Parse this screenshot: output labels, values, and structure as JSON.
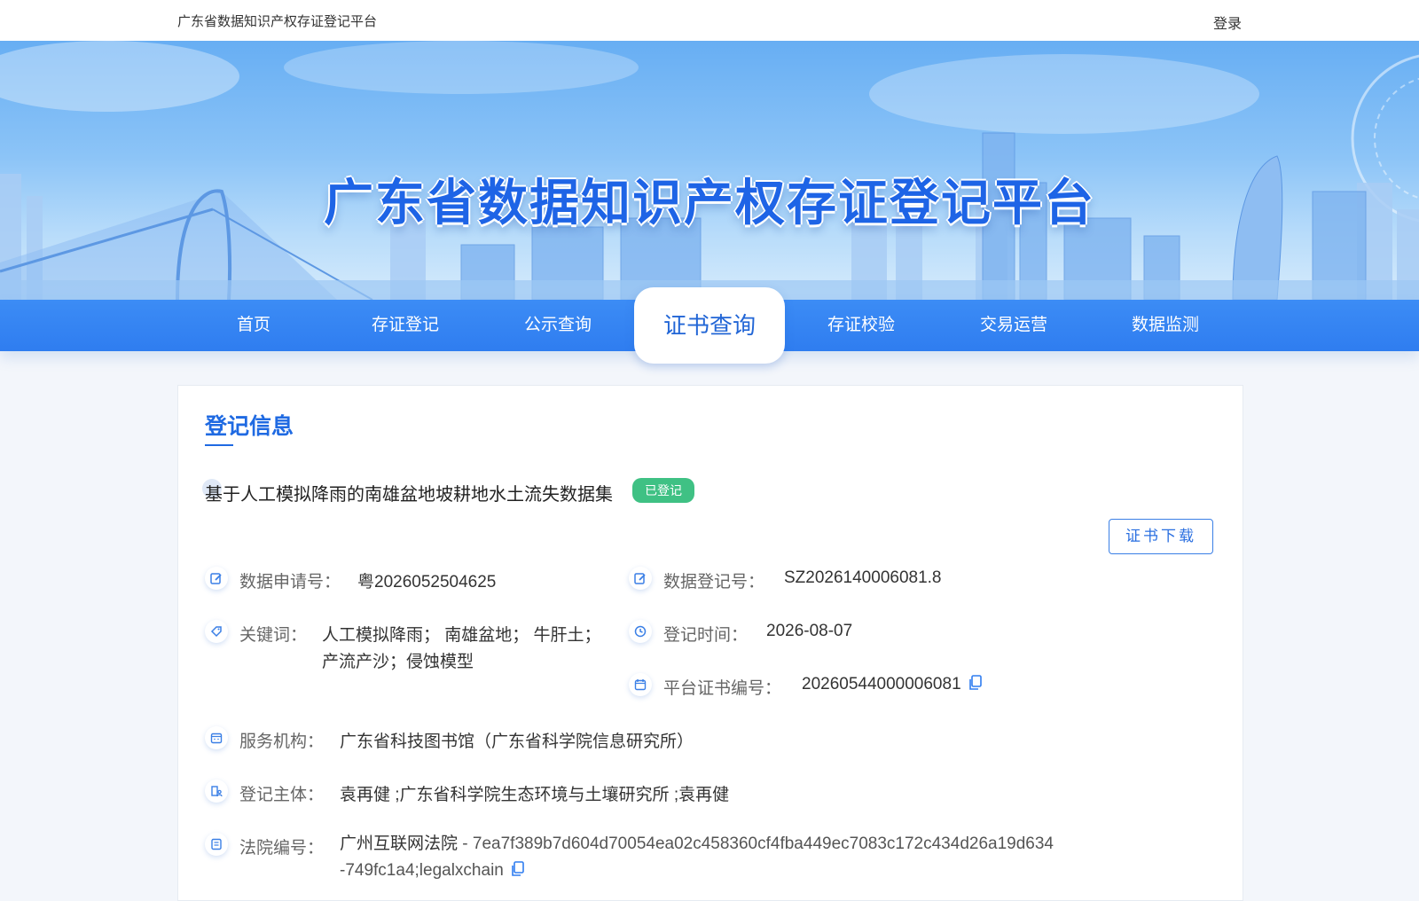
{
  "header": {
    "site_name": "广东省数据知识产权存证登记平台",
    "login": "登录"
  },
  "banner": {
    "title": "广东省数据知识产权存证登记平台"
  },
  "nav": {
    "items": [
      "首页",
      "存证登记",
      "公示查询",
      "证书查询",
      "存证校验",
      "交易运营",
      "数据监测"
    ],
    "active": "证书查询"
  },
  "record": {
    "section_title": "登记信息",
    "dataset_title": "基于人工模拟降雨的南雄盆地坡耕地水土流失数据集",
    "status": "已登记",
    "download_label": "证书下载",
    "fields": {
      "application_no_label": "数据申请号：",
      "application_no": "粤2026052504625",
      "registration_no_label": "数据登记号：",
      "registration_no": "SZ2026140006081.8",
      "keywords_label": "关键词：",
      "keywords_line1": "人工模拟降雨； 南雄盆地； 牛肝土；",
      "keywords_line2": "产流产沙；侵蚀模型",
      "reg_time_label": "登记时间：",
      "reg_time": "2026-08-07",
      "cert_no_label": "平台证书编号：",
      "cert_no": "20260544000006081",
      "agency_label": "服务机构：",
      "agency": "广东省科技图书馆（广东省科学院信息研究所）",
      "subject_label": "登记主体：",
      "subject": "袁再健 ;广东省科学院生态环境与土壤研究所 ;袁再健",
      "court_label": "法院编号：",
      "court_name": "广州互联网法院",
      "court_hash": " - 7ea7f389b7d604d70054ea02c458360cf4fba449ec7083c172c434d26a19d634-749fc1a4;legalxchain"
    }
  },
  "colors": {
    "accent": "#1f6ae2",
    "nav": "#3c8cf5",
    "badge": "#3fc184"
  }
}
